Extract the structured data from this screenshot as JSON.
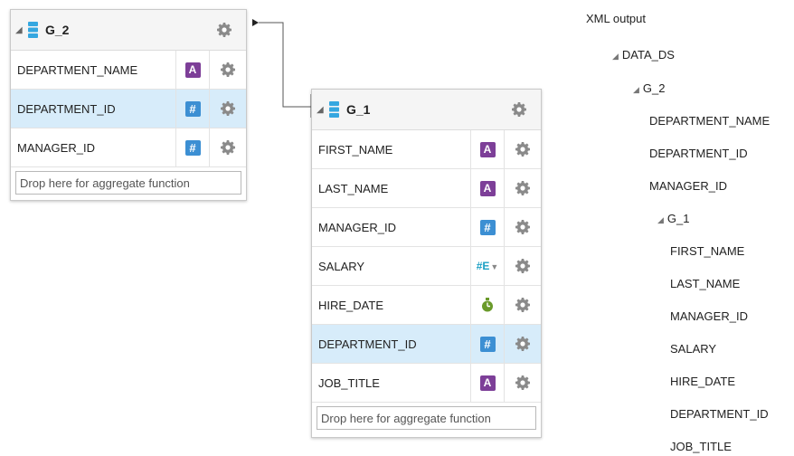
{
  "groups": {
    "g2": {
      "name": "G_2",
      "columns": [
        {
          "name": "DEPARTMENT_NAME",
          "type": "A",
          "selected": false
        },
        {
          "name": "DEPARTMENT_ID",
          "type": "#",
          "selected": true
        },
        {
          "name": "MANAGER_ID",
          "type": "#",
          "selected": false
        }
      ],
      "drop_placeholder": "Drop here for aggregate function"
    },
    "g1": {
      "name": "G_1",
      "columns": [
        {
          "name": "FIRST_NAME",
          "type": "A",
          "selected": false
        },
        {
          "name": "LAST_NAME",
          "type": "A",
          "selected": false
        },
        {
          "name": "MANAGER_ID",
          "type": "#",
          "selected": false
        },
        {
          "name": "SALARY",
          "type": "#E",
          "selected": false
        },
        {
          "name": "HIRE_DATE",
          "type": "date",
          "selected": false
        },
        {
          "name": "DEPARTMENT_ID",
          "type": "#",
          "selected": true
        },
        {
          "name": "JOB_TITLE",
          "type": "A",
          "selected": false
        }
      ],
      "drop_placeholder": "Drop here for aggregate function"
    }
  },
  "xml_output": {
    "title": "XML output",
    "root": "DATA_DS",
    "g2": "G_2",
    "g2_items": [
      "DEPARTMENT_NAME",
      "DEPARTMENT_ID",
      "MANAGER_ID"
    ],
    "g1": "G_1",
    "g1_items": [
      "FIRST_NAME",
      "LAST_NAME",
      "MANAGER_ID",
      "SALARY",
      "HIRE_DATE",
      "DEPARTMENT_ID",
      "JOB_TITLE"
    ]
  },
  "colors": {
    "selected_row": "#d7ecfa",
    "alpha_badge": "#7d3f98",
    "numeric_badge": "#3c8fd3",
    "db_icon": "#35a7e0",
    "date_icon": "#6a9a2a"
  },
  "icons": {
    "collapse": "triangle-down-right-icon",
    "group": "database-icon",
    "settings": "gear-icon",
    "alpha": "alpha-type-icon",
    "numeric": "numeric-type-icon",
    "numeric_expression": "numeric-expression-icon",
    "date": "date-type-icon"
  }
}
